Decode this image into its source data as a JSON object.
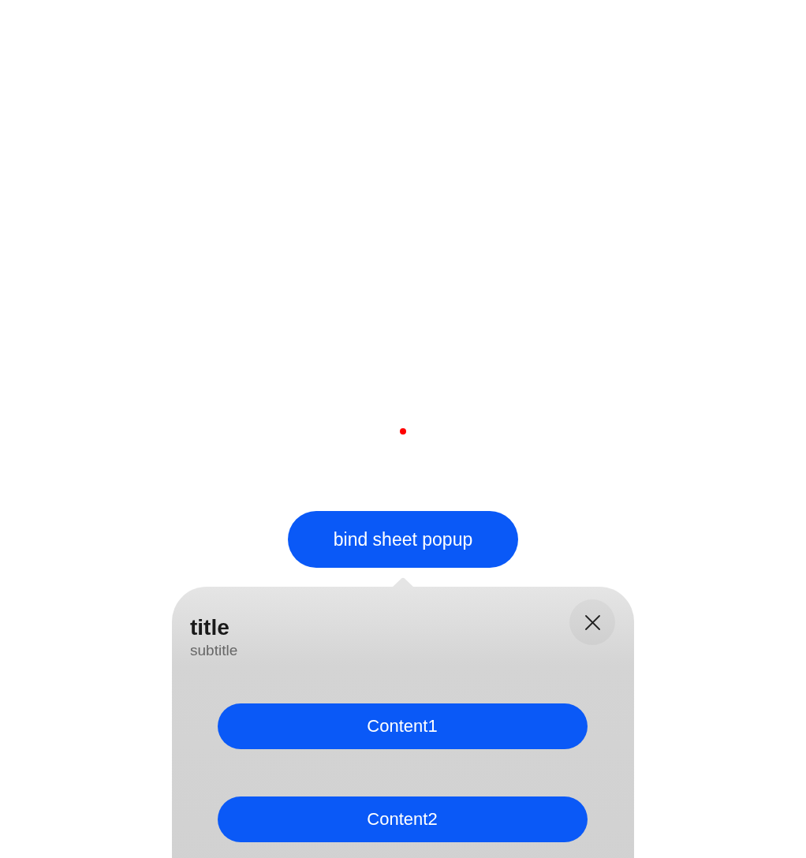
{
  "trigger_button": {
    "label": "bind sheet popup"
  },
  "sheet": {
    "title": "title",
    "subtitle": "subtitle",
    "content_buttons": [
      {
        "label": "Content1"
      },
      {
        "label": "Content2"
      }
    ]
  }
}
